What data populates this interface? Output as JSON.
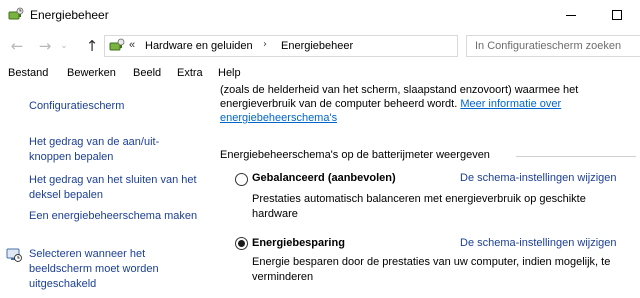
{
  "window": {
    "title": "Energiebeheer"
  },
  "navigation": {
    "chevron": "«",
    "breadcrumb": [
      "Hardware en geluiden",
      "Energiebeheer"
    ],
    "search_placeholder": "In Configuratiescherm zoeken"
  },
  "menu": [
    "Bestand",
    "Bewerken",
    "Beeld",
    "Extra",
    "Help"
  ],
  "sidebar": {
    "home": "Configuratiescherm",
    "links": [
      "Het gedrag van de aan/uit-knoppen bepalen",
      "Het gedrag van het sluiten van het deksel bepalen",
      "Een energiebeheerschema maken",
      "Selecteren wanneer het beeldscherm moet worden uitgeschakeld"
    ]
  },
  "main": {
    "intro_text": "(zoals de helderheid van het scherm, slaapstand enzovoort) waarmee het energieverbruik van de computer beheerd wordt.",
    "intro_link": "Meer informatie over energiebeheerschema's",
    "section_title": "Energiebeheerschema's op de batterijmeter weergeven",
    "plans": [
      {
        "name": "Gebalanceerd (aanbevolen)",
        "link": "De schema-instellingen wijzigen",
        "description": "Prestaties automatisch balanceren met energieverbruik op geschikte hardware",
        "selected": false
      },
      {
        "name": "Energiebesparing",
        "link": "De schema-instellingen wijzigen",
        "description": "Energie besparen door de prestaties van uw computer, indien mogelijk, te verminderen",
        "selected": true
      }
    ]
  },
  "colors": {
    "link": "#1c3f94",
    "hyperlink": "#0066cc"
  }
}
